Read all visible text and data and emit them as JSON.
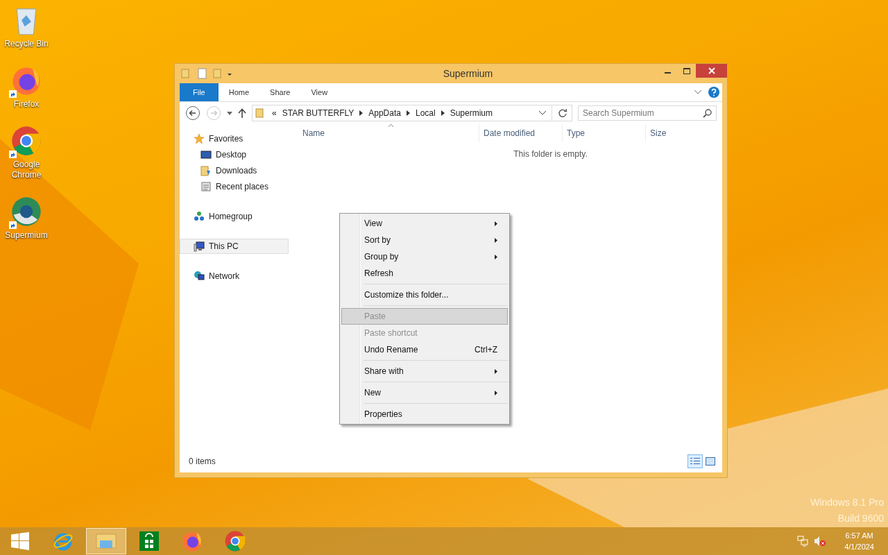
{
  "desktop_icons": [
    {
      "label": "Recycle Bin",
      "kind": "recycle",
      "shortcut": false
    },
    {
      "label": "Firefox",
      "kind": "firefox",
      "shortcut": true
    },
    {
      "label": "Google Chrome",
      "kind": "chrome",
      "shortcut": true
    },
    {
      "label": "Supermium",
      "kind": "supermium",
      "shortcut": true
    }
  ],
  "window": {
    "title": "Supermium",
    "ribbon_tabs": [
      {
        "label": "File",
        "selected": true
      },
      {
        "label": "Home",
        "selected": false
      },
      {
        "label": "Share",
        "selected": false
      },
      {
        "label": "View",
        "selected": false
      }
    ],
    "address": {
      "prefix": "«",
      "segments": [
        "STAR BUTTERFLY",
        "AppData",
        "Local",
        "Supermium"
      ]
    },
    "search": {
      "placeholder": "Search Supermium"
    },
    "nav": [
      {
        "label": "Favorites",
        "kind": "star",
        "selected": false,
        "children": [
          {
            "label": "Desktop",
            "kind": "desktop",
            "selected": false
          },
          {
            "label": "Downloads",
            "kind": "downloads",
            "selected": false
          },
          {
            "label": "Recent places",
            "kind": "recent",
            "selected": false
          }
        ]
      },
      {
        "label": "Homegroup",
        "kind": "homegroup",
        "selected": false
      },
      {
        "label": "This PC",
        "kind": "pc",
        "selected": true
      },
      {
        "label": "Network",
        "kind": "network",
        "selected": false
      }
    ],
    "columns": [
      {
        "label": "Name",
        "sorted": true
      },
      {
        "label": "Date modified",
        "sorted": false
      },
      {
        "label": "Type",
        "sorted": false
      },
      {
        "label": "Size",
        "sorted": false
      }
    ],
    "empty_message": "This folder is empty.",
    "status": "0 items",
    "views": [
      {
        "kind": "details",
        "selected": true
      },
      {
        "kind": "tiles",
        "selected": false
      }
    ]
  },
  "context_menu": [
    [
      {
        "label": "View",
        "submenu": true,
        "disabled": false,
        "selected": false
      },
      {
        "label": "Sort by",
        "submenu": true,
        "disabled": false,
        "selected": false
      },
      {
        "label": "Group by",
        "submenu": true,
        "disabled": false,
        "selected": false
      },
      {
        "label": "Refresh",
        "submenu": false,
        "disabled": false,
        "selected": false
      }
    ],
    [
      {
        "label": "Customize this folder...",
        "submenu": false,
        "disabled": false,
        "selected": false
      }
    ],
    [
      {
        "label": "Paste",
        "submenu": false,
        "disabled": true,
        "selected": true
      },
      {
        "label": "Paste shortcut",
        "submenu": false,
        "disabled": true,
        "selected": false
      },
      {
        "label": "Undo Rename",
        "shortcut": "Ctrl+Z",
        "submenu": false,
        "disabled": false,
        "selected": false
      }
    ],
    [
      {
        "label": "Share with",
        "submenu": true,
        "disabled": false,
        "selected": false
      }
    ],
    [
      {
        "label": "New",
        "submenu": true,
        "disabled": false,
        "selected": false
      }
    ],
    [
      {
        "label": "Properties",
        "submenu": false,
        "disabled": false,
        "selected": false
      }
    ]
  ],
  "edition": [
    "Windows 8.1 Pro",
    "Build 9600"
  ],
  "taskbar": {
    "apps": [
      {
        "kind": "start",
        "selected": false
      },
      {
        "kind": "ie",
        "selected": false
      },
      {
        "kind": "explorer",
        "selected": true
      },
      {
        "kind": "store",
        "selected": false
      },
      {
        "kind": "firefox",
        "selected": false
      },
      {
        "kind": "chrome",
        "selected": false
      }
    ],
    "time": "6:57 AM",
    "date": "4/1/2024",
    "muted": true
  }
}
